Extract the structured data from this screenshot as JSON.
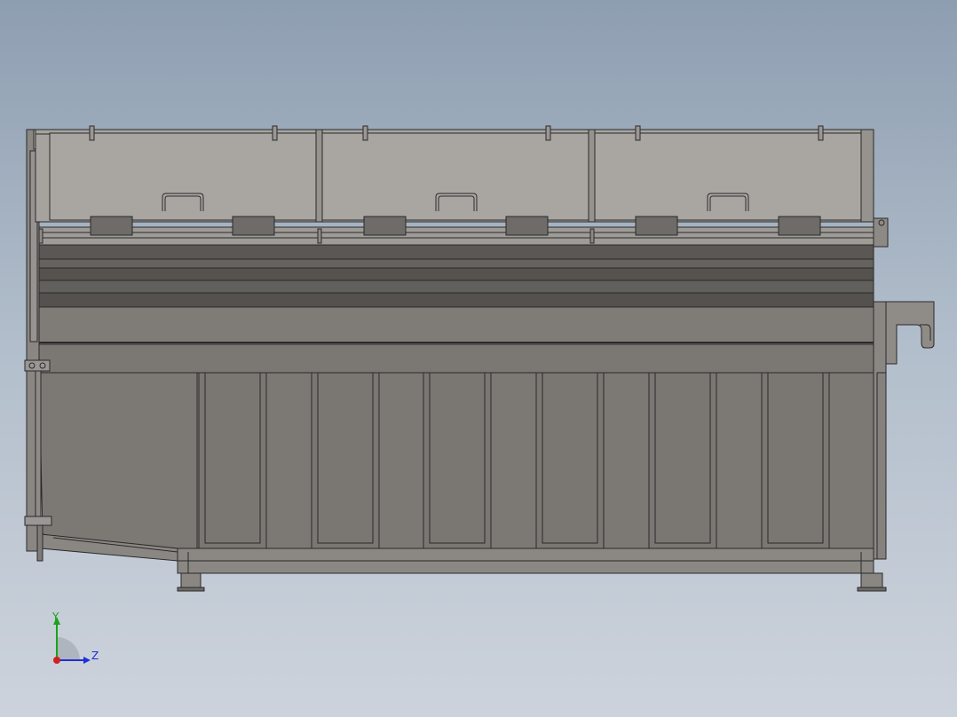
{
  "viewport": {
    "background_top": "#8e9eb1",
    "background_bottom": "#cdd3dc"
  },
  "model": {
    "description_icon": "container-side-view",
    "lid_panels": 3,
    "wall_panels": 6,
    "colors": {
      "lid": "#a6a39f",
      "body": "#7d7a76",
      "dark_band": "#55524f",
      "outline": "#2a2a2a"
    }
  },
  "triad": {
    "y_label": "Y",
    "z_label": "Z",
    "y_color": "#1aa31a",
    "z_color": "#1f2fd6",
    "x_color": "#d02020"
  }
}
